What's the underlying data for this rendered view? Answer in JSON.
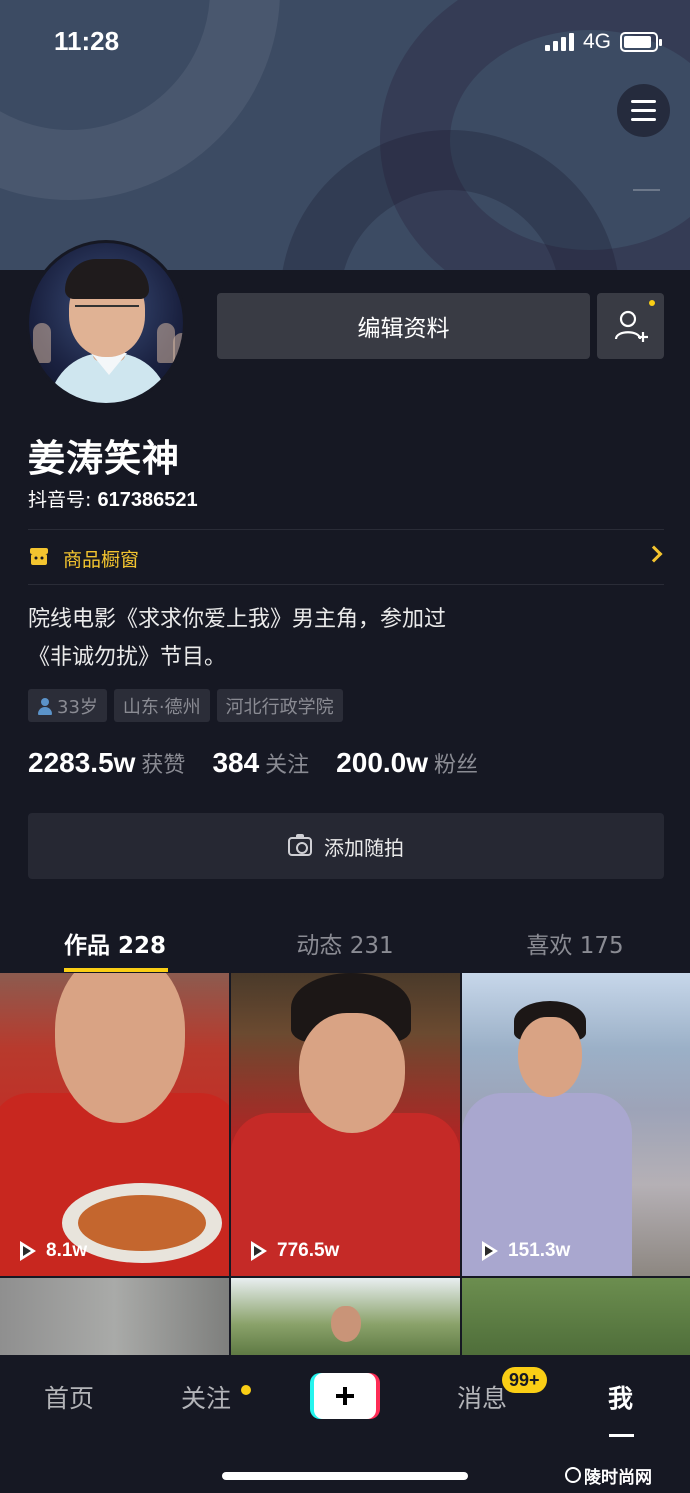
{
  "status_bar": {
    "time": "11:28",
    "network": "4G",
    "battery_level": 0.9
  },
  "header": {
    "menu_icon": "hamburger-menu-icon"
  },
  "profile": {
    "edit_button_label": "编辑资料",
    "add_friend_icon": "add-friend-icon",
    "nickname": "姜涛笑神",
    "douyin_id_label": "抖音号: ",
    "douyin_id_value": "617386521",
    "shop": {
      "label": "商品橱窗",
      "icon": "shop-icon",
      "arrow_icon": "chevron-right-icon",
      "accent_color": "#f3c42f"
    },
    "bio_lines": [
      "院线电影《求求你爱上我》男主角，参加过",
      "《非诚勿扰》节目。"
    ],
    "tags": {
      "age": "33岁",
      "location": "山东·德州",
      "school": "河北行政学院"
    },
    "stats": {
      "likes_value": "2283.5w",
      "likes_label": "获赞",
      "following_value": "384",
      "following_label": "关注",
      "followers_value": "200.0w",
      "followers_label": "粉丝"
    },
    "add_photo_label": "添加随拍"
  },
  "tabs": {
    "works": "作品 228",
    "activity": "动态 231",
    "likes": "喜欢 175",
    "active": "works",
    "active_color": "#face15"
  },
  "videos": [
    {
      "views": "8.1w"
    },
    {
      "views": "776.5w"
    },
    {
      "views": "151.3w"
    },
    {
      "views": ""
    },
    {
      "views": ""
    },
    {
      "views": ""
    }
  ],
  "bottom_nav": {
    "home": "首页",
    "follow": "关注",
    "create_icon": "plus-icon",
    "messages": "消息",
    "messages_badge": "99+",
    "me": "我",
    "active": "me"
  },
  "watermark": "陵时尚网"
}
